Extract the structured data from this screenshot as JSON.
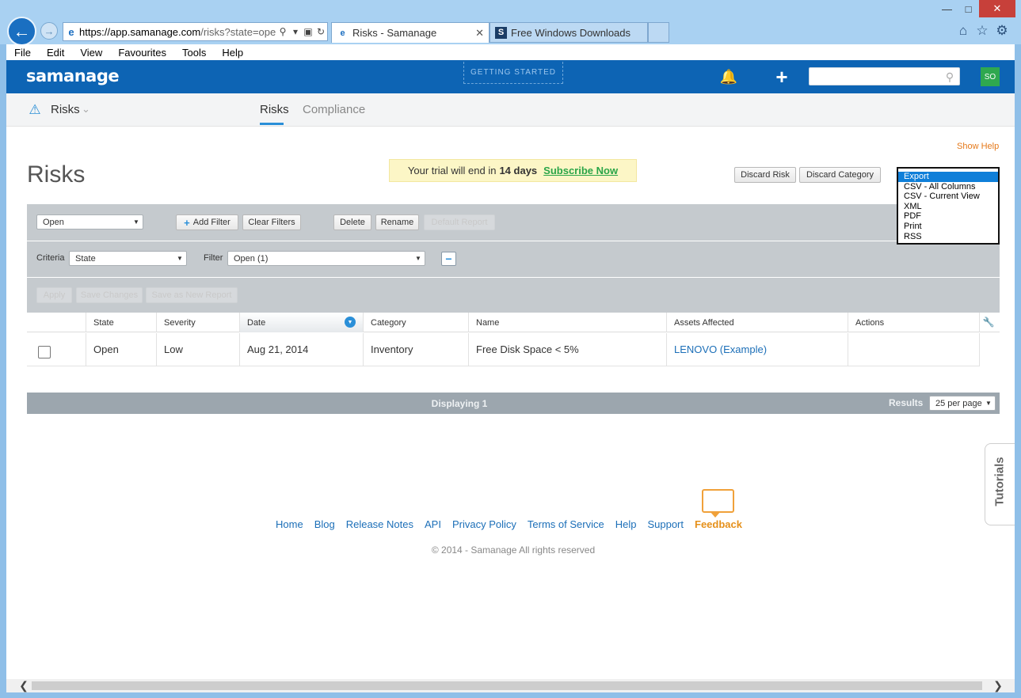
{
  "browser": {
    "address_host": "https://app.samanage.com",
    "address_rest": "/risks?state=ope",
    "tabs": [
      {
        "title": "Risks - Samanage"
      },
      {
        "title": "Free Windows Downloads"
      }
    ],
    "menu": [
      "File",
      "Edit",
      "View",
      "Favourites",
      "Tools",
      "Help"
    ]
  },
  "app": {
    "logo": "samanage",
    "getting_started": "GETTING STARTED",
    "avatar": "SO",
    "module": "Risks",
    "tabs": [
      "Risks",
      "Compliance"
    ]
  },
  "page": {
    "show_help": "Show Help",
    "title": "Risks",
    "trial_prefix": "Your trial will end in",
    "trial_days": "14 days",
    "trial_link": "Subscribe Now",
    "discard_risk": "Discard Risk",
    "discard_category": "Discard Category",
    "export_options": [
      "Export",
      "CSV - All Columns",
      "CSV - Current View",
      "XML",
      "PDF",
      "Print",
      "RSS"
    ]
  },
  "filters": {
    "state": "Open",
    "add_filter": "Add Filter",
    "clear_filters": "Clear Filters",
    "delete": "Delete",
    "rename": "Rename",
    "default_report": "Default Report",
    "criteria_label": "Criteria",
    "criteria_value": "State",
    "filter_label": "Filter",
    "filter_value": "Open (1)",
    "apply": "Apply",
    "save_changes": "Save Changes",
    "save_new": "Save as New Report"
  },
  "table": {
    "headers": [
      "State",
      "Severity",
      "Date",
      "Category",
      "Name",
      "Assets Affected",
      "Actions"
    ],
    "rows": [
      {
        "state": "Open",
        "severity": "Low",
        "date": "Aug 21, 2014",
        "category": "Inventory",
        "name": "Free Disk Space < 5%",
        "assets": "LENOVO (Example)",
        "actions": ""
      }
    ]
  },
  "pagination": {
    "displaying": "Displaying 1",
    "results_label": "Results",
    "per_page": "25 per page"
  },
  "tutorials": "Tutorials",
  "footer": {
    "links": [
      "Home",
      "Blog",
      "Release Notes",
      "API",
      "Privacy Policy",
      "Terms of Service",
      "Help",
      "Support"
    ],
    "feedback": "Feedback",
    "copyright": "© 2014 - Samanage All rights reserved"
  }
}
